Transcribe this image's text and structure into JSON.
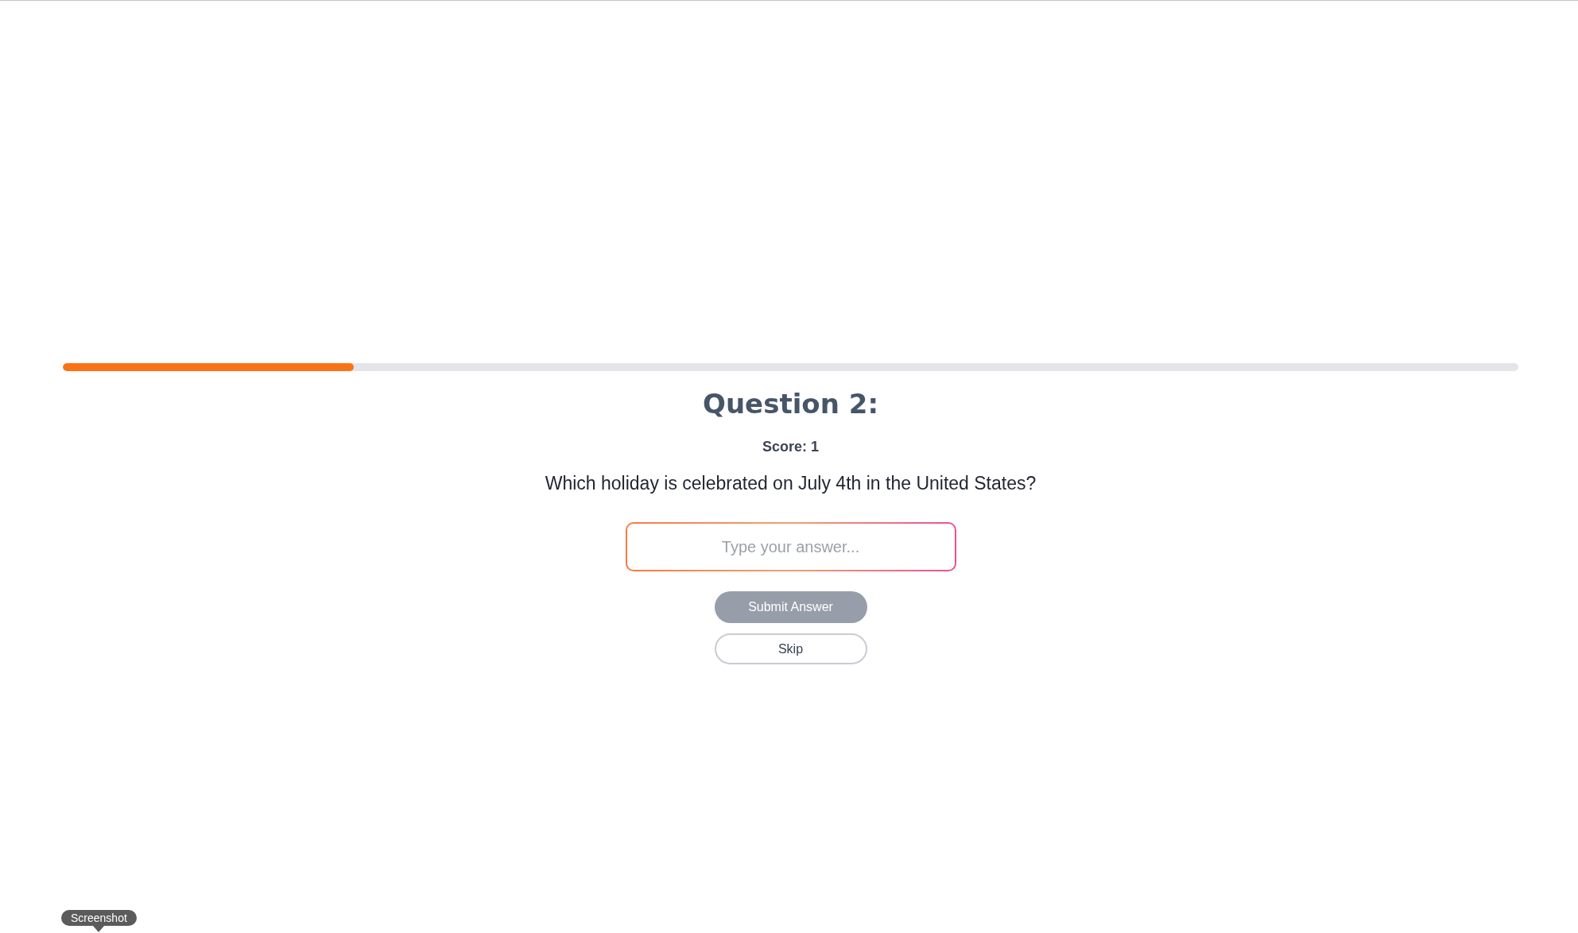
{
  "progress": {
    "level": 0.2
  },
  "question": {
    "heading": "Question 2:",
    "score": "Score: 1",
    "text": "Which holiday is celebrated on July 4th in the United States?"
  },
  "answer": {
    "placeholder": "Type your answer..."
  },
  "buttons": [
    {
      "label": "Submit Answer",
      "kind": "primary",
      "disabled": true
    },
    {
      "label": "Skip",
      "kind": "secondary",
      "disabled": false
    }
  ],
  "tooltip": {
    "text": "Screenshot"
  }
}
